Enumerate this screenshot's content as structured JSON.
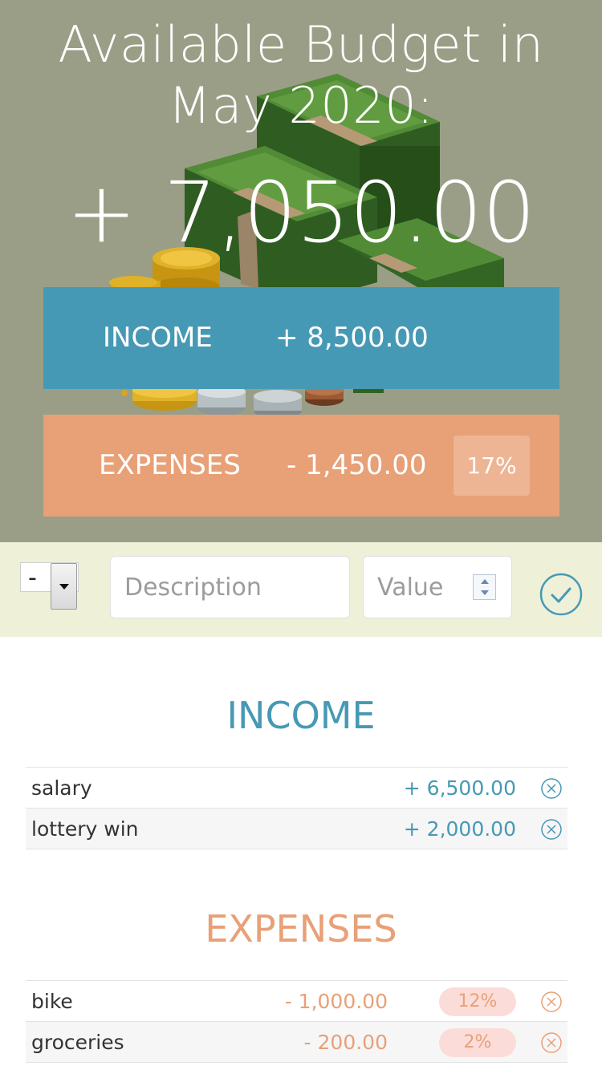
{
  "header": {
    "title": "Available Budget in May 2020:",
    "budget_sign": "+",
    "budget_value": "7,050.00"
  },
  "summary": {
    "income_label": "INCOME",
    "income_value": "+ 8,500.00",
    "expenses_label": "EXPENSES",
    "expenses_value": "- 1,450.00",
    "expenses_percentage": "17%"
  },
  "add_form": {
    "type_value": "-",
    "description_placeholder": "Description",
    "value_placeholder": "Value",
    "submit_icon": "check-circle-icon"
  },
  "income_list": {
    "title": "INCOME",
    "items": [
      {
        "description": "salary",
        "value": "+ 6,500.00"
      },
      {
        "description": "lottery win",
        "value": "+ 2,000.00"
      }
    ]
  },
  "expenses_list": {
    "title": "EXPENSES",
    "items": [
      {
        "description": "bike",
        "value": "- 1,000.00",
        "percentage": "12%"
      },
      {
        "description": "groceries",
        "value": "- 200.00",
        "percentage": "2%"
      }
    ]
  },
  "colors": {
    "income": "#4699b5",
    "expenses": "#e8a077",
    "hero_bg": "#9a9e86",
    "add_bar_bg": "#eef1d8",
    "percent_badge_bg": "#fcdcd8"
  }
}
